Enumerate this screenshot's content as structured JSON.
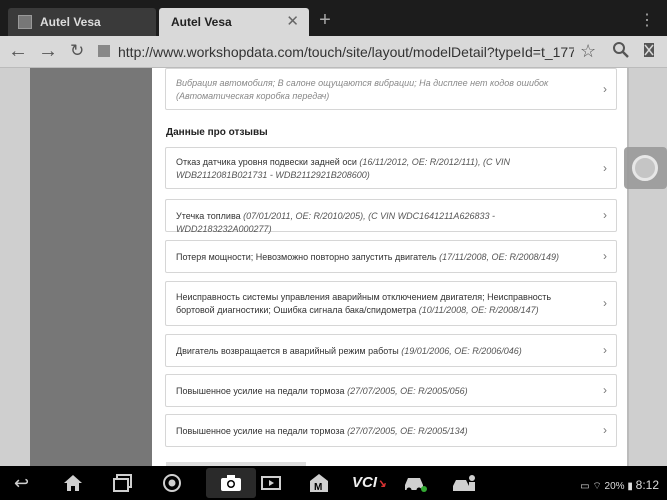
{
  "browser": {
    "tabs": [
      {
        "label": "Autel Vesa"
      },
      {
        "label": "Autel Vesa"
      }
    ],
    "url": "http://www.workshopdata.com/touch/site/layout/modelDetail?typeId=t_17780&c"
  },
  "top_card": {
    "text": "Вибрация автомобиля; В салоне ощущаются вибрации; На дисплее нет кодов ошибок (Автоматическая коробка передач)"
  },
  "section_title": "Данные про отзывы",
  "recalls": [
    {
      "title": "Отказ датчика уровня подвески задней оси",
      "meta": "(16/11/2012, OE: R/2012/111), (C VIN WDB2112081B021731 - WDB2112921B208600)"
    },
    {
      "title": "Утечка топлива",
      "meta": "(07/01/2011, OE: R/2010/205), (C VIN WDC1641211A626833 - WDD2183232A000277)"
    },
    {
      "title": "Потеря мощности; Невозможно повторно запустить двигатель",
      "meta": "(17/11/2008, OE: R/2008/149)"
    },
    {
      "title": "Неисправность системы управления аварийным отключением двигателя; Неисправность бортовой диагностики; Ошибка сигнала бака/спидометра",
      "meta": "(10/11/2008, OE: R/2008/147)"
    },
    {
      "title": "Двигатель возвращается в аварийный режим работы",
      "meta": "(19/01/2006, OE: R/2006/046)"
    },
    {
      "title": "Повышенное усилие на педали тормоза",
      "meta": "(27/07/2005, OE: R/2005/056)"
    },
    {
      "title": "Повышенное усилие на педали тормоза",
      "meta": "(27/07/2005, OE: R/2005/134)"
    }
  ],
  "status_bar": {
    "battery": "20%",
    "time": "8:12"
  },
  "system_icons": [
    "back-icon",
    "home-icon",
    "recent-apps-icon",
    "chrome-icon",
    "camera-icon",
    "screen-record-icon",
    "m-app-icon",
    "vci-icon",
    "car-icon",
    "car-person-icon"
  ]
}
